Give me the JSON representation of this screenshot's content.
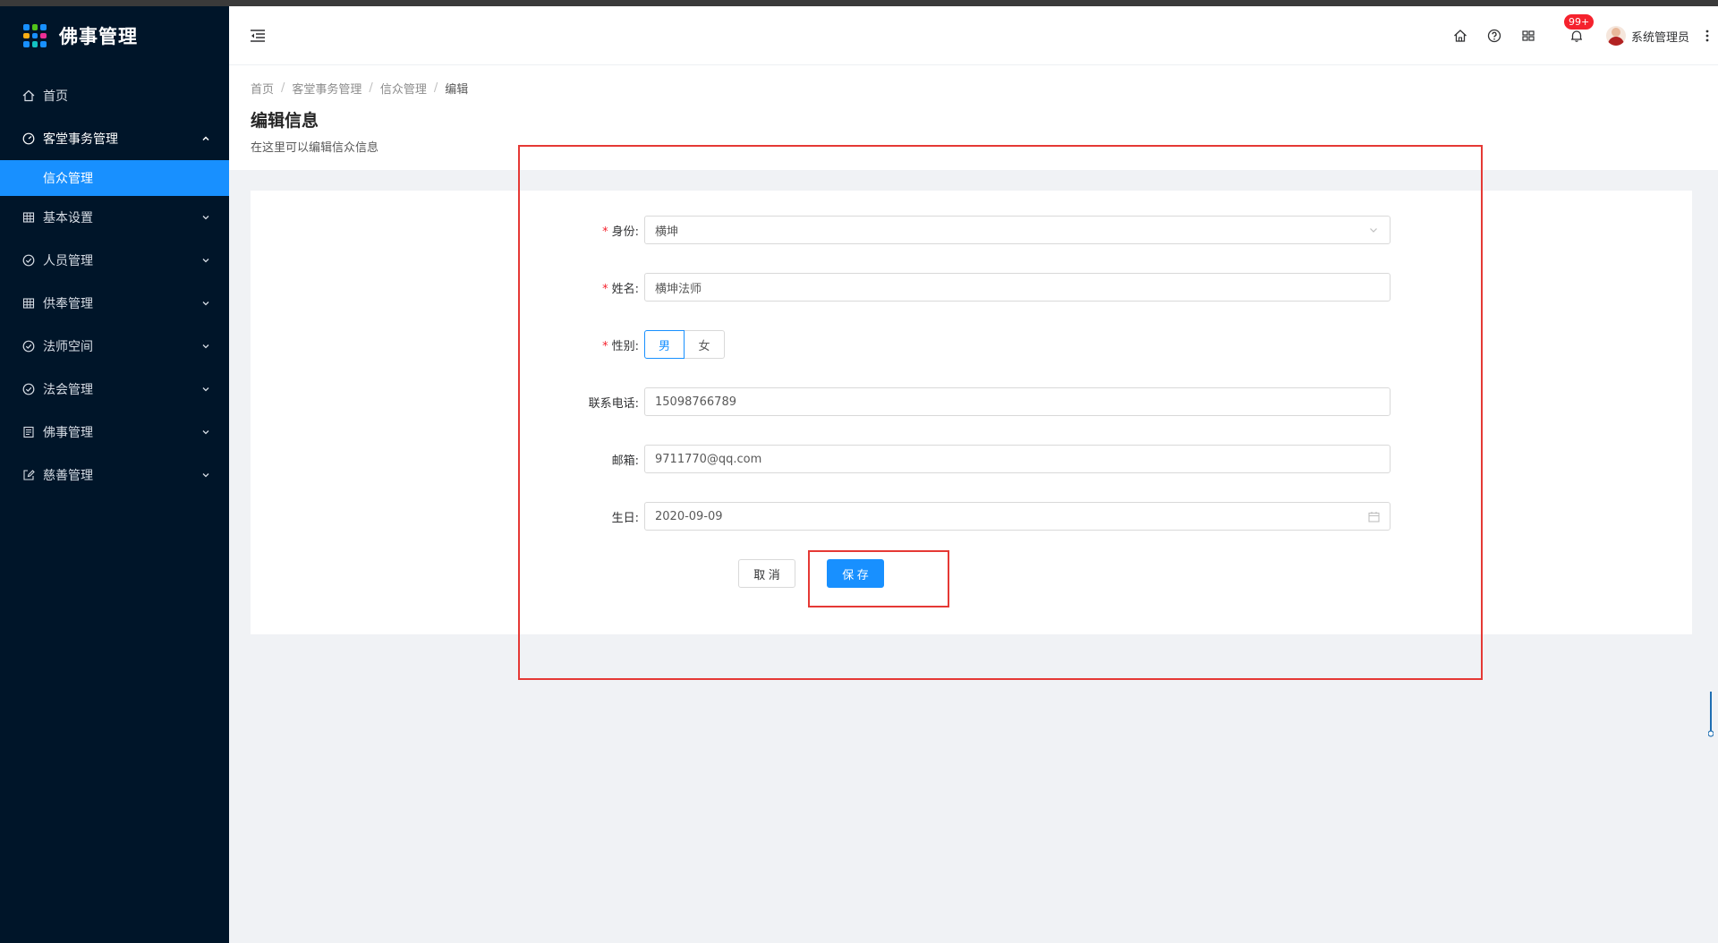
{
  "app": {
    "title": "佛事管理",
    "logo_colors": [
      "#1890ff",
      "#52c41a",
      "#1890ff",
      "#faad14",
      "#1890ff",
      "#eb2f96",
      "#1890ff",
      "#13c2c2",
      "#1890ff"
    ]
  },
  "sidebar": {
    "items": [
      {
        "label": "首页",
        "icon": "home-icon",
        "has_arrow": false
      },
      {
        "label": "客堂事务管理",
        "icon": "dashboard-icon",
        "has_arrow": true,
        "open": true
      },
      {
        "label": "信众管理",
        "sub": true,
        "active": true
      },
      {
        "label": "基本设置",
        "icon": "table-icon",
        "has_arrow": true
      },
      {
        "label": "人员管理",
        "icon": "check-circle-icon",
        "has_arrow": true
      },
      {
        "label": "供奉管理",
        "icon": "table-icon",
        "has_arrow": true
      },
      {
        "label": "法师空间",
        "icon": "check-circle-icon",
        "has_arrow": true
      },
      {
        "label": "法会管理",
        "icon": "check-circle-icon",
        "has_arrow": true
      },
      {
        "label": "佛事管理",
        "icon": "profile-icon",
        "has_arrow": true
      },
      {
        "label": "慈善管理",
        "icon": "edit-icon",
        "has_arrow": true
      }
    ]
  },
  "header": {
    "badge": "99+",
    "user_name": "系统管理员"
  },
  "breadcrumb": {
    "items": [
      "首页",
      "客堂事务管理",
      "信众管理"
    ],
    "current": "编辑"
  },
  "page": {
    "title": "编辑信息",
    "description": "在这里可以编辑信众信息"
  },
  "form": {
    "identity_label": "身份:",
    "identity_value": "横坤",
    "name_label": "姓名:",
    "name_value": "横坤法师",
    "gender_label": "性别:",
    "gender_options": [
      "男",
      "女"
    ],
    "gender_selected": "男",
    "phone_label": "联系电话:",
    "phone_value": "15098766789",
    "email_label": "邮箱:",
    "email_value": "9711770@qq.com",
    "birthday_label": "生日:",
    "birthday_value": "2020-09-09",
    "cancel_label": "取 消",
    "save_label": "保 存"
  },
  "colors": {
    "sidebar_bg": "#001529",
    "primary": "#1890ff",
    "annotation": "#e53935",
    "required": "#f5222d"
  }
}
